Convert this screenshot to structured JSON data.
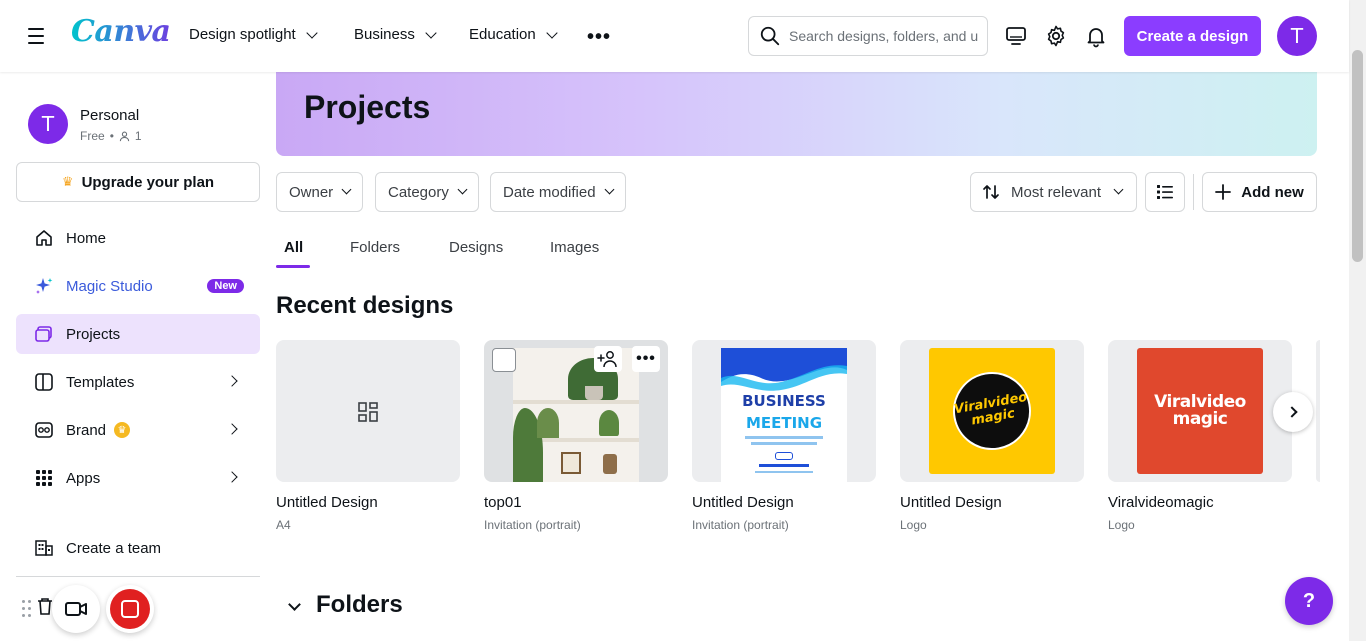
{
  "header": {
    "logo": "Canva",
    "nav": [
      {
        "label": "Design spotlight"
      },
      {
        "label": "Business"
      },
      {
        "label": "Education"
      }
    ],
    "more_label": "•••",
    "search_placeholder": "Search designs, folders, and uploads",
    "create_label": "Create a design",
    "avatar_letter": "T",
    "icons": [
      "menu-icon",
      "more-horizontal-icon",
      "search-icon",
      "desktop-icon",
      "gear-icon",
      "bell-icon"
    ]
  },
  "sidebar": {
    "account_name": "Personal",
    "account_plan": "Free",
    "member_count": "1",
    "avatar_letter": "T",
    "upgrade_label": "Upgrade your plan",
    "items": [
      {
        "label": "Home",
        "icon": "home-icon"
      },
      {
        "label": "Magic Studio",
        "icon": "sparkle-icon",
        "badge": "New"
      },
      {
        "label": "Projects",
        "icon": "folder-icon"
      },
      {
        "label": "Templates",
        "icon": "template-icon"
      },
      {
        "label": "Brand",
        "icon": "brand-icon"
      },
      {
        "label": "Apps",
        "icon": "apps-grid-icon"
      }
    ],
    "create_team_label": "Create a team"
  },
  "main": {
    "page_title": "Projects",
    "filters": [
      {
        "label": "Owner"
      },
      {
        "label": "Category"
      },
      {
        "label": "Date modified"
      }
    ],
    "sort_label": "Most relevant",
    "add_new_label": "Add new",
    "tabs": [
      {
        "label": "All",
        "active": true
      },
      {
        "label": "Folders"
      },
      {
        "label": "Designs"
      },
      {
        "label": "Images"
      }
    ],
    "recent_title": "Recent designs",
    "designs": [
      {
        "title": "Untitled Design",
        "subtitle": "A4"
      },
      {
        "title": "top01",
        "subtitle": "Invitation (portrait)"
      },
      {
        "title": "Untitled Design",
        "subtitle": "Invitation (portrait)",
        "thumb_text": [
          "BUSINESS",
          "MEETING"
        ]
      },
      {
        "title": "Untitled Design",
        "subtitle": "Logo",
        "thumb_text": "Viralvideo magic"
      },
      {
        "title": "Viralvideomagic",
        "subtitle": "Logo",
        "thumb_text": "Viralvideo magic"
      }
    ],
    "folders_title": "Folders"
  },
  "help_label": "?",
  "colors": {
    "accent": "#8b3dff",
    "active_nav_bg": "#ede2fd",
    "magic_studio_text": "#3b5bdb",
    "record_red": "#e02020"
  }
}
